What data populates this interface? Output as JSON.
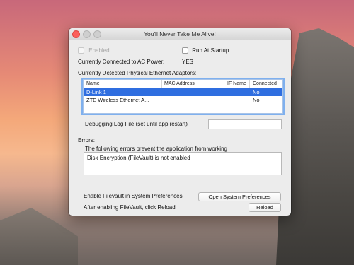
{
  "window": {
    "title": "You'll Never Take Me Alive!"
  },
  "options": {
    "enabled_label": "Enabled",
    "run_at_startup_label": "Run At Startup"
  },
  "power": {
    "label": "Currently Connected to AC Power:",
    "value": "YES"
  },
  "adaptors": {
    "heading": "Currently Detected Physical Ethernet Adaptors:",
    "columns": [
      "Name",
      "MAC Address",
      "IF Name",
      "Connected"
    ],
    "rows": [
      {
        "name": "D-Link 1",
        "mac": "",
        "ifname": "",
        "connected": "No",
        "selected": true
      },
      {
        "name": "ZTE Wireless Ethernet A...",
        "mac": "",
        "ifname": "",
        "connected": "No",
        "selected": false
      }
    ]
  },
  "debug": {
    "label": "Debugging Log File (set until app restart)",
    "value": ""
  },
  "errors": {
    "heading": "Errors:",
    "description": "The following errors prevent the application from working",
    "text": "Disk Encryption (FileVault) is not enabled"
  },
  "filevault": {
    "label": "Enable Filevault in System Preferences",
    "button": "Open System Preferences"
  },
  "reload": {
    "label": "After enabling FileVault, click Reload",
    "button": "Reload"
  },
  "colors": {
    "selection": "#2f6ee0",
    "close": "#fc605b"
  }
}
